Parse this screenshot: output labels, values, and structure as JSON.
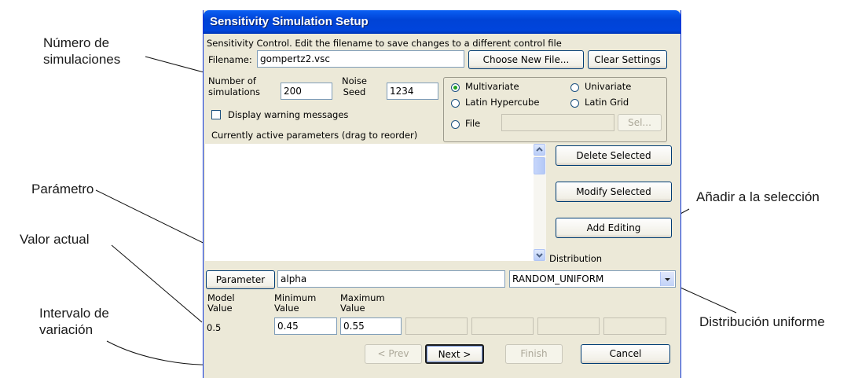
{
  "annotations": {
    "num_sims": [
      "Número de",
      "simulaciones"
    ],
    "parameter": "Parámetro",
    "current_value": "Valor actual",
    "range": [
      "Intervalo de",
      "variación"
    ],
    "add_selection": "Añadir a la selección",
    "uniform_dist": "Distribución uniforme"
  },
  "dialog": {
    "title": "Sensitivity Simulation Setup",
    "info_text": "Sensitivity Control.  Edit the filename to save changes to a different control file",
    "filename_label": "Filename:",
    "filename_value": "gompertz2.vsc",
    "choose_new_file": "Choose New File...",
    "clear_settings": "Clear Settings",
    "num_sims_label": [
      "Number of",
      "simulations"
    ],
    "num_sims_value": "200",
    "noise_seed_label": [
      "Noise",
      "Seed"
    ],
    "noise_seed_value": "1234",
    "sampling": {
      "multivariate": "Multivariate",
      "univariate": "Univariate",
      "latin_hypercube": "Latin Hypercube",
      "latin_grid": "Latin Grid",
      "file": "File",
      "sel_button": "Sel...",
      "selected": "Multivariate"
    },
    "display_warnings": "Display warning messages",
    "active_params_label": "Currently active parameters (drag to reorder)",
    "delete_selected": "Delete Selected",
    "modify_selected": "Modify Selected",
    "add_editing": "Add Editing",
    "distribution_label": "Distribution",
    "parameter_button": "Parameter",
    "parameter_value": "alpha",
    "distribution_value": "RANDOM_UNIFORM",
    "model_value_label": [
      "Model",
      "Value"
    ],
    "minimum_value_label": [
      "Minimum",
      "Value"
    ],
    "maximum_value_label": [
      "Maximum",
      "Value"
    ],
    "model_value": "0.5",
    "minimum_value": "0.45",
    "maximum_value": "0.55",
    "prev": "< Prev",
    "next": "Next >",
    "finish": "Finish",
    "cancel": "Cancel"
  },
  "colors": {
    "title_bar": "#0043d6",
    "dialog_bg": "#ece9d8",
    "radio_dot": "#21a121"
  }
}
